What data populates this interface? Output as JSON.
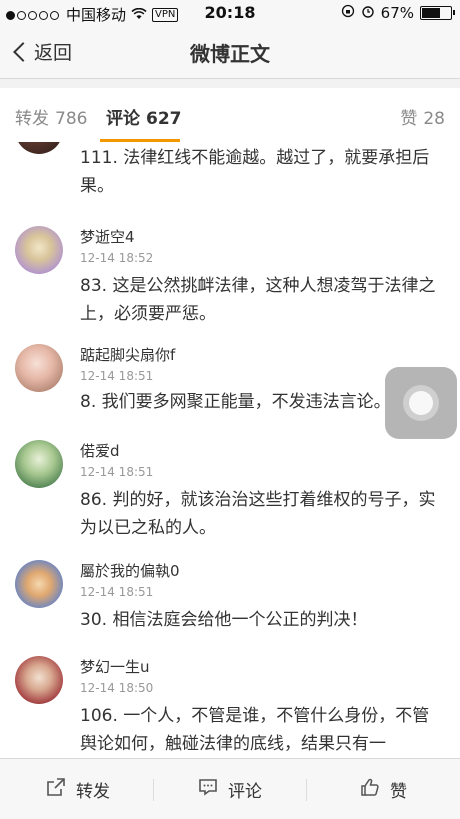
{
  "status_bar": {
    "carrier": "中国移动",
    "vpn": "VPN",
    "time": "20:18",
    "battery": "67%"
  },
  "nav": {
    "back_label": "返回",
    "title": "微博正文"
  },
  "tabs": {
    "repost": {
      "label": "转发",
      "count": "786"
    },
    "comments": {
      "label": "评论",
      "count": "627"
    },
    "likes": {
      "label": "赞",
      "count": "28"
    }
  },
  "comments": [
    {
      "name": "",
      "time": "",
      "text": "111. 法律红线不能逾越。越过了，就要承担后果。"
    },
    {
      "name": "梦逝空4",
      "time": "12-14 18:52",
      "text": "83. 这是公然挑衅法律，这种人想凌驾于法律之上，必须要严惩。"
    },
    {
      "name": "踮起脚尖扇你f",
      "time": "12-14 18:51",
      "text": "8. 我们要多网聚正能量，不发违法言论。"
    },
    {
      "name": "偌爱d",
      "time": "12-14 18:51",
      "text": "86. 判的好，就该治治这些打着维权的号子，实为以已之私的人。"
    },
    {
      "name": "屬於我的偏執0",
      "time": "12-14 18:51",
      "text": "30. 相信法庭会给他一个公正的判决！"
    },
    {
      "name": "梦幻一生u",
      "time": "12-14 18:50",
      "text": "106. 一个人，不管是谁，不管什么身份，不管舆论如何，触碰法律的底线，结果只有一"
    }
  ],
  "bottom_bar": {
    "repost_label": "转发",
    "comment_label": "评论",
    "like_label": "赞"
  },
  "colors": {
    "accent": "#f39800",
    "text": "#333333",
    "muted": "#999999"
  }
}
